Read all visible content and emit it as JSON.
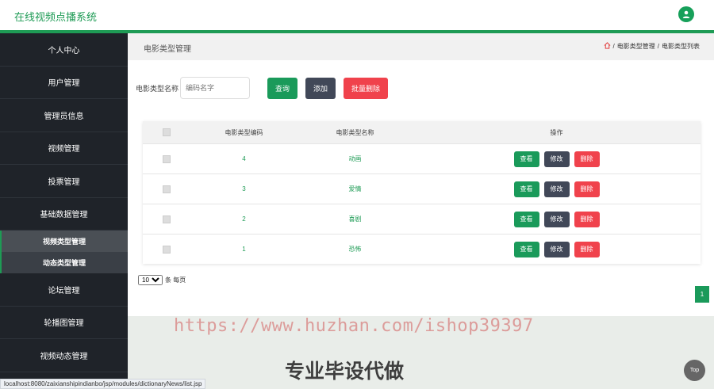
{
  "app": {
    "title": "在线视频点播系统"
  },
  "sidebar": {
    "items": [
      {
        "label": "个人中心"
      },
      {
        "label": "用户管理"
      },
      {
        "label": "管理员信息"
      },
      {
        "label": "视频管理"
      },
      {
        "label": "投票管理"
      },
      {
        "label": "基础数据管理"
      }
    ],
    "subitems": [
      {
        "label": "视频类型管理"
      },
      {
        "label": "动态类型管理"
      }
    ],
    "items2": [
      {
        "label": "论坛管理"
      },
      {
        "label": "轮播图管理"
      },
      {
        "label": "视频动态管理"
      }
    ]
  },
  "page": {
    "title": "电影类型管理",
    "breadcrumb": [
      "电影类型管理",
      "电影类型列表"
    ]
  },
  "search": {
    "label": "电影类型名称",
    "placeholder": "编码名字",
    "query_label": "查询",
    "add_label": "添加",
    "batch_delete_label": "批量删除"
  },
  "table": {
    "headers": [
      "电影类型编码",
      "电影类型名称",
      "操作"
    ],
    "rows": [
      {
        "code": "4",
        "name": "动画"
      },
      {
        "code": "3",
        "name": "爱情"
      },
      {
        "code": "2",
        "name": "喜剧"
      },
      {
        "code": "1",
        "name": "恐怖"
      }
    ],
    "actions": {
      "view": "查看",
      "edit": "修改",
      "delete": "删除"
    }
  },
  "pagination": {
    "page_size": "10",
    "per_page_label": "条 每页",
    "current_page": "1"
  },
  "watermark": "https://www.huzhan.com/ishop39397",
  "ad_text": "专业毕设代做",
  "top_label": "Top",
  "status_url": "localhost:8080/zaixianshipindianbo/jsp/modules/dictionaryNews/list.jsp",
  "colors": {
    "accent": "#1e9b55",
    "sidebar": "#1f2329",
    "danger": "#f0424c",
    "dark_button": "#414858"
  }
}
